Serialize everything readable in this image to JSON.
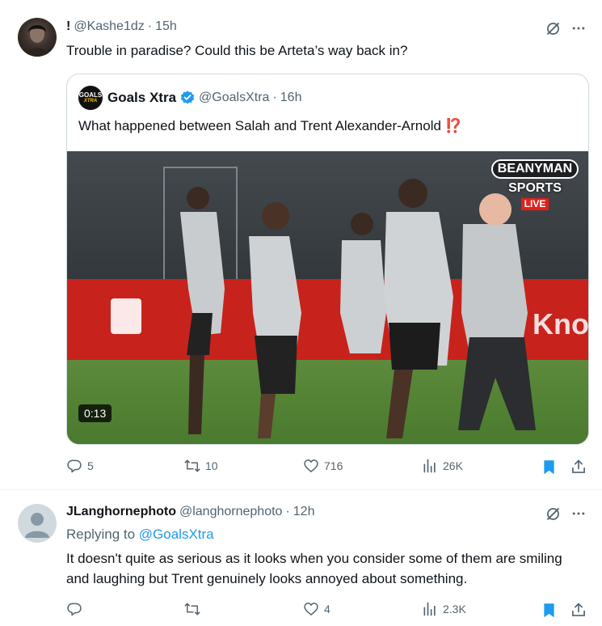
{
  "post1": {
    "display_name": "!",
    "handle": "@Kashe1dz",
    "time": "15h",
    "text": "Trouble in paradise? Could this be Arteta’s way back in?",
    "quote": {
      "display_name": "Goals Xtra",
      "handle": "@GoalsXtra",
      "time": "16h",
      "logo_text": "GOALS",
      "logo_subtext": "XTRA",
      "text": "What happened between Salah and Trent Alexander-Arnold",
      "emoji": "⁉️",
      "video": {
        "duration": "0:13",
        "watermark_line1": "BEANYMAN",
        "watermark_line2": "SPORTS",
        "watermark_live": "LIVE",
        "board_text": "Kno"
      }
    },
    "actions": {
      "replies": "5",
      "reposts": "10",
      "likes": "716",
      "views": "26K"
    }
  },
  "post2": {
    "display_name": "JLanghornephoto",
    "handle": "@langhornephoto",
    "time": "12h",
    "replying_label": "Replying to",
    "replying_handle": "@GoalsXtra",
    "text": "It doesn't quite as serious as it looks when you consider some of them are smiling and laughing but Trent genuinely looks annoyed about something.",
    "actions": {
      "replies": "",
      "reposts": "",
      "likes": "4",
      "views": "2.3K"
    }
  },
  "separator": "·",
  "colors": {
    "accent": "#1d9bf0",
    "text": "#0f1419",
    "muted": "#536471",
    "border": "#cfd9de",
    "live_red": "#e0201b"
  },
  "icons": [
    "grok-icon",
    "more-icon",
    "verified-icon",
    "reply-icon",
    "repost-icon",
    "like-icon",
    "views-icon",
    "bookmark-icon",
    "share-icon"
  ]
}
